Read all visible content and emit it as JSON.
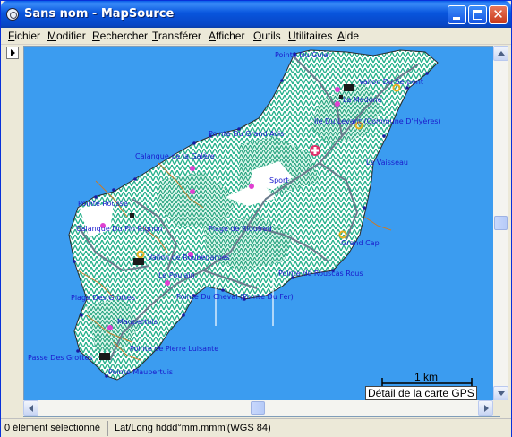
{
  "window": {
    "title": "Sans nom - MapSource",
    "close_glyph": "✕"
  },
  "menu": {
    "items": [
      {
        "label": "Fichier"
      },
      {
        "label": "Modifier"
      },
      {
        "label": "Rechercher"
      },
      {
        "label": "Transférer"
      },
      {
        "label": "Afficher"
      },
      {
        "label": "Outils"
      },
      {
        "label": "Utilitaires"
      },
      {
        "label": "Aide"
      }
    ]
  },
  "map": {
    "colors": {
      "sea": "#3b9cf0",
      "land": "#ffffff",
      "vegetation": "#23b08a",
      "roads": "#6a7a8c",
      "tracks": "#c87a2a",
      "label": "#1a1acc"
    },
    "labels": [
      {
        "name": "Pointe Du Guier"
      },
      {
        "name": "Vallon Du Serpent"
      },
      {
        "name": "La Madone"
      },
      {
        "name": "Ile Du Levant (Commune D'Hyères)"
      },
      {
        "name": "Pointe Du Grand Avis"
      },
      {
        "name": "Le Vaisseau"
      },
      {
        "name": "Calanque de la Galère"
      },
      {
        "name": "Sport"
      },
      {
        "name": "Pointe Rousse"
      },
      {
        "name": "Calanque Du Pin Rignon"
      },
      {
        "name": "Plage de Rioufred"
      },
      {
        "name": "Grand Cap"
      },
      {
        "name": "Vallon de Roubegarbes"
      },
      {
        "name": "Pointe de Rouscas Rous"
      },
      {
        "name": "Le Poulain"
      },
      {
        "name": "Plage Des Grottes"
      },
      {
        "name": "Pointe Du Cheval (Pointe Du Fer)"
      },
      {
        "name": "Maupertuis"
      },
      {
        "name": "Pointe de Pierre Luisante"
      },
      {
        "name": "Passe Des Grottes"
      },
      {
        "name": "Pointe Maupertuis"
      }
    ],
    "scale_label": "1 km",
    "detail_label": "Détail de la carte GPS"
  },
  "status": {
    "selection": "0 élément sélectionné",
    "coord_format": "Lat/Long hddd°mm.mmm'(WGS 84)"
  }
}
